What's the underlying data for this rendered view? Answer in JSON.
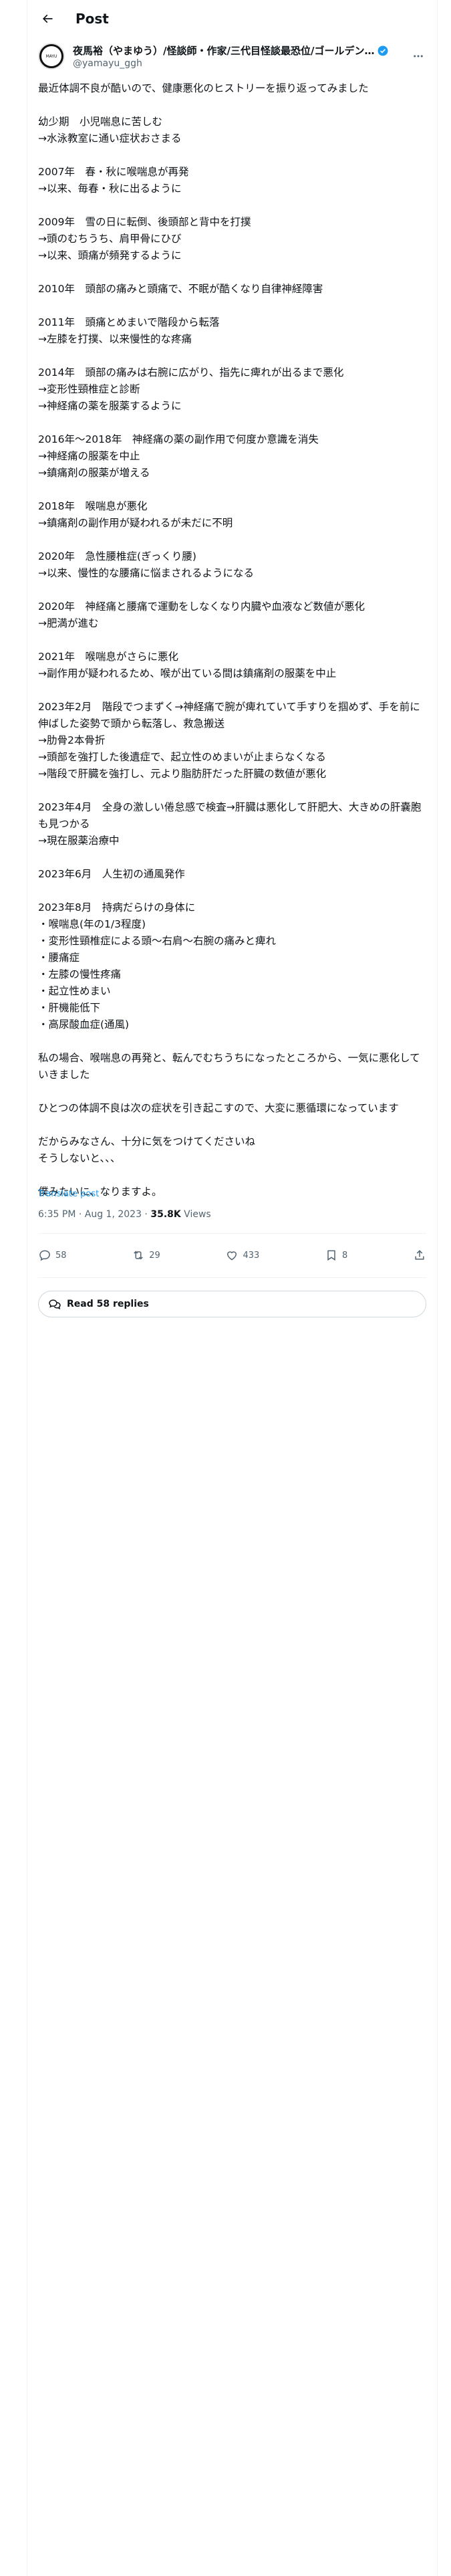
{
  "header": {
    "title": "Post"
  },
  "author": {
    "display_name": "夜馬裕（やまゆう）/怪談師・作家/三代目怪談最恐位/ゴールデン…",
    "handle": "@yamayu_ggh",
    "avatar_text": "MAYU"
  },
  "post": {
    "text": "最近体調不良が酷いので、健康悪化のヒストリーを振り返ってみました\n\n幼少期　小児喘息に苦しむ\n→水泳教室に通い症状おさまる\n\n2007年　春・秋に喉喘息が再発\n→以来、毎春・秋に出るように\n\n2009年　雪の日に転倒、後頭部と背中を打撲\n→頭のむちうち、肩甲骨にひび\n→以来、頭痛が頻発するように\n\n2010年　頭部の痛みと頭痛で、不眠が酷くなり自律神経障害\n\n2011年　頭痛とめまいで階段から転落\n→左膝を打撲、以来慢性的な疼痛\n\n2014年　頭部の痛みは右腕に広がり、指先に痺れが出るまで悪化\n→変形性頸椎症と診断\n→神経痛の薬を服薬するように\n\n2016年〜2018年　神経痛の薬の副作用で何度か意識を消失\n→神経痛の服薬を中止\n→鎮痛剤の服薬が増える\n\n2018年　喉喘息が悪化\n→鎮痛剤の副作用が疑われるが未だに不明\n\n2020年　急性腰椎症(ぎっくり腰)\n→以来、慢性的な腰痛に悩まされるようになる\n\n2020年　神経痛と腰痛で運動をしなくなり内臓や血液など数値が悪化\n→肥満が進む\n\n2021年　喉喘息がさらに悪化\n→副作用が疑われるため、喉が出ている間は鎮痛剤の服薬を中止\n\n2023年2月　階段でつまずく→神経痛で腕が痺れていて手すりを掴めず、手を前に伸ばした姿勢で頭から転落し、救急搬送\n→肋骨2本骨折\n→頭部を強打した後遺症で、起立性のめまいが止まらなくなる\n→階段で肝臓を強打し、元より脂肪肝だった肝臓の数値が悪化\n\n2023年4月　全身の激しい倦怠感で検査→肝臓は悪化して肝肥大、大きめの肝嚢胞も見つかる\n→現在服薬治療中\n\n2023年6月　人生初の通風発作\n\n2023年8月　持病だらけの身体に\n・喉喘息(年の1/3程度)\n・変形性頸椎症による頭〜右肩〜右腕の痛みと痺れ\n・腰痛症\n・左膝の慢性疼痛\n・起立性めまい\n・肝機能低下\n・高尿酸血症(通風)\n\n私の場合、喉喘息の再発と、転んでむちうちになったところから、一気に悪化していきました\n\nひとつの体調不良は次の症状を引き起こすので、大変に悪循環になっています\n\nだからみなさん、十分に気をつけてくださいね\nそうしないと、、、\n\n僕みたいに、なりますよ。",
    "translate_label": "Translate post",
    "timestamp": "6:35 PM · Aug 1, 2023 · ",
    "views_count": "35.8K",
    "views_label": " Views"
  },
  "actions": {
    "replies": "58",
    "reposts": "29",
    "likes": "433",
    "bookmarks": "8"
  },
  "read_replies_label": "Read 58 replies",
  "colors": {
    "accent": "#1d9bf0",
    "secondary_text": "#536471",
    "border": "#eff3f4"
  }
}
